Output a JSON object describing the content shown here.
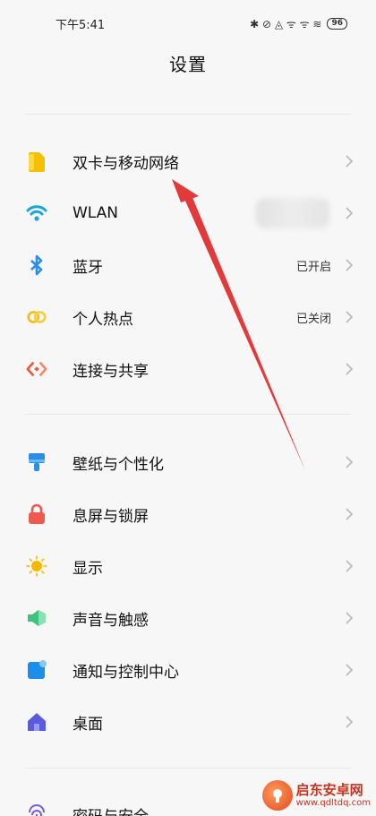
{
  "status_bar": {
    "time": "下午5:41",
    "indicators": "✱ ⊘ ◬ ᯤ ᯤ ≋",
    "battery": "96"
  },
  "header": {
    "title": "设置"
  },
  "sections": [
    {
      "items": [
        {
          "id": "sim",
          "label": "双卡与移动网络",
          "icon": "sim-card-icon",
          "color": "#f5c000"
        },
        {
          "id": "wlan",
          "label": "WLAN",
          "icon": "wifi-icon",
          "color": "#1aa6d8"
        },
        {
          "id": "bluetooth",
          "label": "蓝牙",
          "value": "已开启",
          "icon": "bluetooth-icon",
          "color": "#2a8ee8"
        },
        {
          "id": "hotspot",
          "label": "个人热点",
          "value": "已关闭",
          "icon": "hotspot-icon",
          "color": "#f0c020"
        },
        {
          "id": "connection",
          "label": "连接与共享",
          "icon": "share-icon",
          "color": "#ee5a40"
        }
      ]
    },
    {
      "items": [
        {
          "id": "wallpaper",
          "label": "壁纸与个性化",
          "icon": "paintbrush-icon",
          "color": "#2a8ee8"
        },
        {
          "id": "lockscreen",
          "label": "息屏与锁屏",
          "icon": "lock-icon",
          "color": "#ee5a50"
        },
        {
          "id": "display",
          "label": "显示",
          "icon": "sun-icon",
          "color": "#f5b800"
        },
        {
          "id": "sound",
          "label": "声音与触感",
          "icon": "speaker-icon",
          "color": "#3cc47a"
        },
        {
          "id": "notification",
          "label": "通知与控制中心",
          "icon": "notification-icon",
          "color": "#1a8ee8"
        },
        {
          "id": "desktop",
          "label": "桌面",
          "icon": "home-icon",
          "color": "#5a5ae0"
        }
      ]
    },
    {
      "items": [
        {
          "id": "security",
          "label": "密码与安全",
          "icon": "fingerprint-icon",
          "color": "#7a5ae0"
        }
      ]
    }
  ],
  "watermark": {
    "title": "启东安卓网",
    "url": "www.qdltdq.com"
  }
}
